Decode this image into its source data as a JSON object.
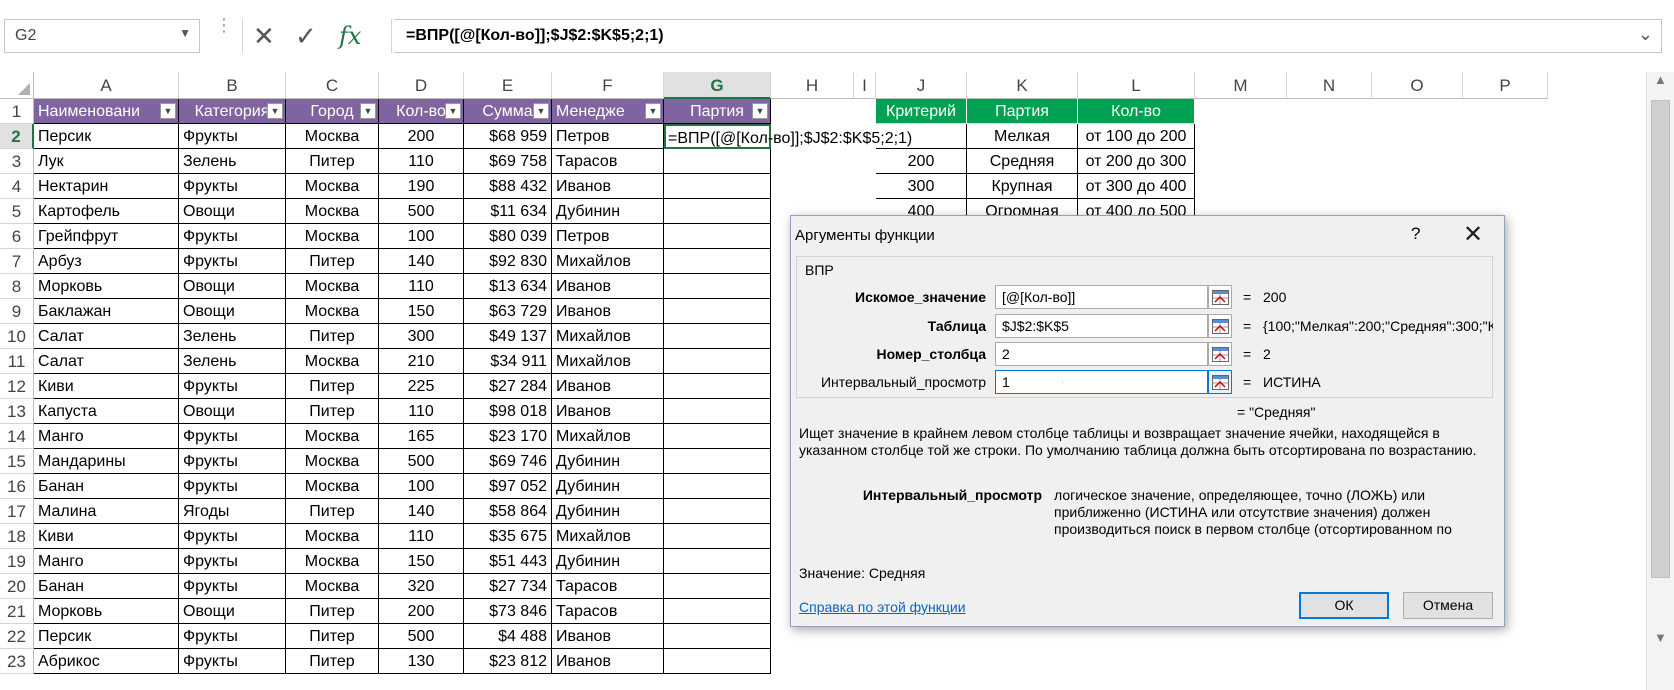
{
  "name_box": {
    "value": "G2"
  },
  "formula_bar": {
    "cancel_icon": "✕",
    "enter_icon": "✓",
    "fx_icon": "fx",
    "formula": "=ВПР([@[Кол-во]];$J$2:$K$5;2;1)"
  },
  "columns": [
    "A",
    "B",
    "C",
    "D",
    "E",
    "F",
    "G",
    "H",
    "I",
    "J",
    "K",
    "L",
    "M",
    "N",
    "O",
    "P"
  ],
  "active_column": "G",
  "active_row": "2",
  "rows": [
    "1",
    "2",
    "3",
    "4",
    "5",
    "6",
    "7",
    "8",
    "9",
    "10",
    "11",
    "12",
    "13",
    "14",
    "15",
    "16",
    "17",
    "18",
    "19",
    "20",
    "21",
    "22",
    "23"
  ],
  "table": {
    "headers": [
      "Наименовани",
      "Категория",
      "Город",
      "Кол-во",
      "Сумма",
      "Менедже",
      "Партия"
    ],
    "header_color": "#8064a2",
    "editing_cell": "=ВПР([@[Кол-во]];$J$2:$K$5;2;1)",
    "data": [
      [
        "Персик",
        "Фрукты",
        "Москва",
        "200",
        "$68 959",
        "Петров"
      ],
      [
        "Лук",
        "Зелень",
        "Питер",
        "110",
        "$69 758",
        "Тарасов"
      ],
      [
        "Нектарин",
        "Фрукты",
        "Москва",
        "190",
        "$88 432",
        "Иванов"
      ],
      [
        "Картофель",
        "Овощи",
        "Москва",
        "500",
        "$11 634",
        "Дубинин"
      ],
      [
        "Грейпфрут",
        "Фрукты",
        "Москва",
        "100",
        "$80 039",
        "Петров"
      ],
      [
        "Арбуз",
        "Фрукты",
        "Питер",
        "140",
        "$92 830",
        "Михайлов"
      ],
      [
        "Морковь",
        "Овощи",
        "Москва",
        "110",
        "$13 634",
        "Иванов"
      ],
      [
        "Баклажан",
        "Овощи",
        "Москва",
        "150",
        "$63 729",
        "Иванов"
      ],
      [
        "Салат",
        "Зелень",
        "Питер",
        "300",
        "$49 137",
        "Михайлов"
      ],
      [
        "Салат",
        "Зелень",
        "Москва",
        "210",
        "$34 911",
        "Михайлов"
      ],
      [
        "Киви",
        "Фрукты",
        "Питер",
        "225",
        "$27 284",
        "Иванов"
      ],
      [
        "Капуста",
        "Овощи",
        "Питер",
        "110",
        "$98 018",
        "Иванов"
      ],
      [
        "Манго",
        "Фрукты",
        "Москва",
        "165",
        "$23 170",
        "Михайлов"
      ],
      [
        "Мандарины",
        "Фрукты",
        "Москва",
        "500",
        "$69 746",
        "Дубинин"
      ],
      [
        "Банан",
        "Фрукты",
        "Москва",
        "100",
        "$97 052",
        "Дубинин"
      ],
      [
        "Малина",
        "Ягоды",
        "Питер",
        "140",
        "$58 864",
        "Дубинин"
      ],
      [
        "Киви",
        "Фрукты",
        "Москва",
        "110",
        "$35 675",
        "Михайлов"
      ],
      [
        "Манго",
        "Фрукты",
        "Москва",
        "150",
        "$51 443",
        "Дубинин"
      ],
      [
        "Банан",
        "Фрукты",
        "Москва",
        "320",
        "$27 734",
        "Тарасов"
      ],
      [
        "Морковь",
        "Овощи",
        "Питер",
        "200",
        "$73 846",
        "Тарасов"
      ],
      [
        "Персик",
        "Фрукты",
        "Питер",
        "500",
        "$4 488",
        "Иванов"
      ],
      [
        "Абрикос",
        "Фрукты",
        "Питер",
        "130",
        "$23 812",
        "Иванов"
      ]
    ]
  },
  "criteria": {
    "headers": [
      "Критерий",
      "Партия",
      "Кол-во"
    ],
    "header_color": "#00a152",
    "rows": [
      [
        "",
        "Мелкая",
        "от 100 до 200"
      ],
      [
        "200",
        "Средняя",
        "от 200 до 300"
      ],
      [
        "300",
        "Крупная",
        "от 300 до 400"
      ],
      [
        "400",
        "Огромная",
        "от 400 до 500"
      ]
    ]
  },
  "dialog": {
    "title": "Аргументы функции",
    "help_label": "?",
    "close_label": "✕",
    "function_name": "ВПР",
    "args": [
      {
        "label": "Искомое_значение",
        "value": "[@[Кол-во]]",
        "eq": "=",
        "result": "200"
      },
      {
        "label": "Таблица",
        "value": "$J$2:$K$5",
        "eq": "=",
        "result": "{100;\"Мелкая\":200;\"Средняя\":300;\"К"
      },
      {
        "label": "Номер_столбца",
        "value": "2",
        "eq": "=",
        "result": "2"
      },
      {
        "label": "Интервальный_просмотр",
        "value": "1",
        "eq": "=",
        "result": "ИСТИНА"
      }
    ],
    "formula_result": "=  \"Средняя\"",
    "description": "Ищет значение в крайнем левом столбце таблицы и возвращает значение ячейки, находящейся в указанном столбце той же строки. По умолчанию таблица должна быть отсортирована по возрастанию.",
    "arg_help_label": "Интервальный_просмотр",
    "arg_help_text": "логическое значение, определяющее, точно (ЛОЖЬ) или приближенно (ИСТИНА или отсутствие значения) должен производиться поиск в первом столбце (отсортированном по",
    "value_line": "Значение:   Средняя",
    "help_link": "Справка по этой функции",
    "ok_label": "ОК",
    "cancel_label": "Отмена"
  }
}
